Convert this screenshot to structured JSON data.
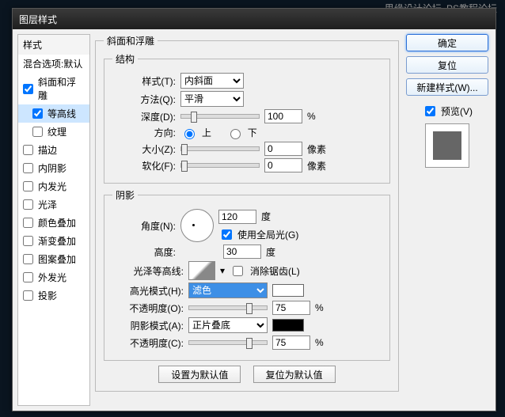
{
  "watermark": {
    "line1": "思缘设计论坛",
    "line2": "PS教程论坛"
  },
  "title": "图层样式",
  "sidebar": {
    "header": "样式",
    "blend": "混合选项:默认",
    "items": [
      {
        "label": "斜面和浮雕",
        "checked": true,
        "sub": false,
        "selected": false
      },
      {
        "label": "等高线",
        "checked": true,
        "sub": true,
        "selected": true
      },
      {
        "label": "纹理",
        "checked": false,
        "sub": true,
        "selected": false
      },
      {
        "label": "描边",
        "checked": false,
        "sub": false,
        "selected": false
      },
      {
        "label": "内阴影",
        "checked": false,
        "sub": false,
        "selected": false
      },
      {
        "label": "内发光",
        "checked": false,
        "sub": false,
        "selected": false
      },
      {
        "label": "光泽",
        "checked": false,
        "sub": false,
        "selected": false
      },
      {
        "label": "颜色叠加",
        "checked": false,
        "sub": false,
        "selected": false
      },
      {
        "label": "渐变叠加",
        "checked": false,
        "sub": false,
        "selected": false
      },
      {
        "label": "图案叠加",
        "checked": false,
        "sub": false,
        "selected": false
      },
      {
        "label": "外发光",
        "checked": false,
        "sub": false,
        "selected": false
      },
      {
        "label": "投影",
        "checked": false,
        "sub": false,
        "selected": false
      }
    ]
  },
  "panel": {
    "title": "斜面和浮雕",
    "structure_legend": "结构",
    "style_label": "样式(T):",
    "style_value": "内斜面",
    "technique_label": "方法(Q):",
    "technique_value": "平滑",
    "depth_label": "深度(D):",
    "depth_value": "100",
    "percent": "%",
    "direction_label": "方向:",
    "dir_up": "上",
    "dir_down": "下",
    "size_label": "大小(Z):",
    "size_value": "0",
    "px": "像素",
    "soften_label": "软化(F):",
    "soften_value": "0",
    "shading_legend": "阴影",
    "angle_label": "角度(N):",
    "angle_value": "120",
    "deg": "度",
    "global_light": "使用全局光(G)",
    "altitude_label": "高度:",
    "altitude_value": "30",
    "gloss_label": "光泽等高线:",
    "antialias": "消除锯齿(L)",
    "highlight_mode_label": "高光模式(H):",
    "highlight_mode_value": "滤色",
    "highlight_color": "#ffffff",
    "opacity1_label": "不透明度(O):",
    "opacity1_value": "75",
    "shadow_mode_label": "阴影模式(A):",
    "shadow_mode_value": "正片叠底",
    "shadow_color": "#000000",
    "opacity2_label": "不透明度(C):",
    "opacity2_value": "75",
    "make_default": "设置为默认值",
    "reset_default": "复位为默认值"
  },
  "buttons": {
    "ok": "确定",
    "cancel": "复位",
    "new_style": "新建样式(W)...",
    "preview": "预览(V)"
  }
}
